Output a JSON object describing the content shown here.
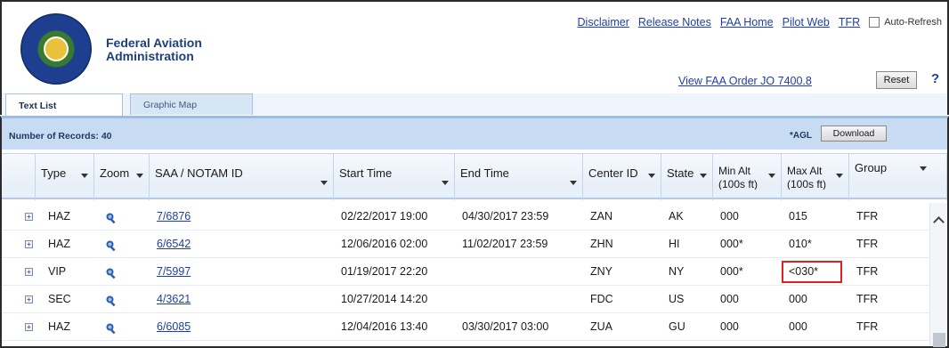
{
  "header": {
    "agency_line1": "Federal Aviation",
    "agency_line2": "Administration",
    "links": [
      "Disclaimer",
      "Release Notes",
      "FAA Home",
      "Pilot Web",
      "TFR"
    ],
    "auto_refresh_label": "Auto-Refresh",
    "auto_refresh_checked": false,
    "order_link": "View FAA Order JO 7400.8",
    "reset_label": "Reset",
    "help_glyph": "?"
  },
  "tabs": [
    {
      "label": "Text List",
      "active": true
    },
    {
      "label": "Graphic Map",
      "active": false
    }
  ],
  "records": {
    "count_label": "Number of Records: 40",
    "agl_label": "*AGL",
    "download_label": "Download"
  },
  "columns": [
    "Type",
    "Zoom",
    "SAA / NOTAM ID",
    "Start Time",
    "End Time",
    "Center ID",
    "State",
    "Min Alt (100s ft)",
    "Max Alt (100s ft)",
    "Group"
  ],
  "columns_split": {
    "min_alt_1": "Min Alt",
    "min_alt_2": "(100s ft)",
    "max_alt_1": "Max Alt",
    "max_alt_2": "(100s ft)"
  },
  "rows": [
    {
      "type": "HAZ",
      "notam": "7/6876",
      "start": "02/22/2017 19:00",
      "end": "04/30/2017 23:59",
      "center": "ZAN",
      "state": "AK",
      "min_alt": "000",
      "max_alt": "015",
      "group": "TFR"
    },
    {
      "type": "HAZ",
      "notam": "6/6542",
      "start": "12/06/2016 02:00",
      "end": "11/02/2017 23:59",
      "center": "ZHN",
      "state": "HI",
      "min_alt": "000*",
      "max_alt": "010*",
      "group": "TFR"
    },
    {
      "type": "VIP",
      "notam": "7/5997",
      "start": "01/19/2017 22:20",
      "end": "",
      "center": "ZNY",
      "state": "NY",
      "min_alt": "000*",
      "max_alt": "<030*",
      "group": "TFR",
      "highlight_max_alt": true
    },
    {
      "type": "SEC",
      "notam": "4/3621",
      "start": "10/27/2014 14:20",
      "end": "",
      "center": "FDC",
      "state": "US",
      "min_alt": "000",
      "max_alt": "000",
      "group": "TFR"
    },
    {
      "type": "HAZ",
      "notam": "6/6085",
      "start": "12/04/2016 13:40",
      "end": "03/30/2017 03:00",
      "center": "ZUA",
      "state": "GU",
      "min_alt": "000",
      "max_alt": "000",
      "group": "TFR"
    }
  ],
  "icons": {
    "zoom": "magnifier-icon",
    "expand": "plus-box-icon",
    "sort_dropdown": "chevron-down-icon"
  },
  "colors": {
    "link": "#1f3f9f",
    "highlight_box": "#e0211f",
    "header_bar": "#c7dcf2"
  }
}
